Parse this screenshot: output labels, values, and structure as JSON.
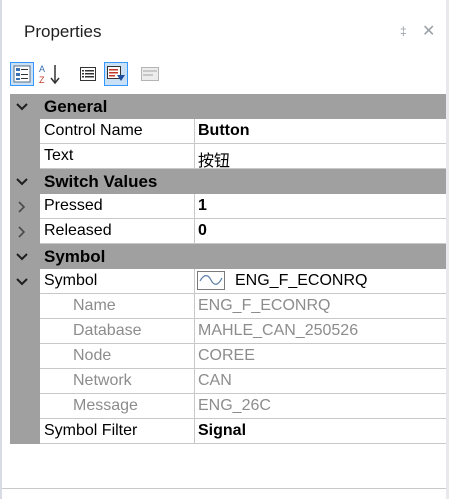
{
  "panel": {
    "title": "Properties",
    "pin_glyph": "‡",
    "close_glyph": "✕"
  },
  "toolbar": {
    "buttons": [
      {
        "icon": "categorized-icon",
        "active": true
      },
      {
        "icon": "alphabetical-sort-icon",
        "active": false
      },
      {
        "icon": "properties-list-icon",
        "active": false
      },
      {
        "icon": "events-icon",
        "active": true
      },
      {
        "icon": "property-pages-icon",
        "active": false,
        "disabled": true
      }
    ]
  },
  "categories": {
    "general": "General",
    "switch_values": "Switch Values",
    "symbol": "Symbol"
  },
  "properties": {
    "control_name": {
      "name": "Control Name",
      "value": "Button"
    },
    "text": {
      "name": "Text",
      "value": "按钮"
    },
    "pressed": {
      "name": "Pressed",
      "value": "1"
    },
    "released": {
      "name": "Released",
      "value": "0"
    },
    "symbol": {
      "name": "Symbol",
      "value": "ENG_F_ECONRQ"
    },
    "symbol_name": {
      "name": "Name",
      "value": "ENG_F_ECONRQ"
    },
    "database": {
      "name": "Database",
      "value": "MAHLE_CAN_250526"
    },
    "node": {
      "name": "Node",
      "value": "COREE"
    },
    "network": {
      "name": "Network",
      "value": "CAN"
    },
    "message": {
      "name": "Message",
      "value": "ENG_26C"
    },
    "symbol_filter": {
      "name": "Symbol Filter",
      "value": "Signal"
    }
  },
  "colors": {
    "category_bg": "#a0a0a0",
    "toolbar_active": "#c9e0f7",
    "readonly_text": "#8c8c8c"
  }
}
